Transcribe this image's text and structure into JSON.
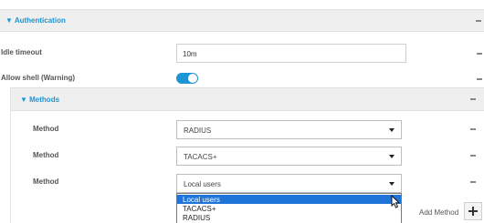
{
  "authentication": {
    "title": "▼ Authentication",
    "idle_timeout": {
      "label": "Idle timeout",
      "value": "10m"
    },
    "allow_shell": {
      "label": "Allow shell (Warning)",
      "enabled": true
    }
  },
  "methods": {
    "title": "▼ Methods",
    "rows": [
      {
        "label": "Method",
        "value": "RADIUS"
      },
      {
        "label": "Method",
        "value": "TACACS+"
      },
      {
        "label": "Method",
        "value": "Local users"
      }
    ],
    "dropdown_options": [
      {
        "label": "Local users",
        "selected": true
      },
      {
        "label": "TACACS+",
        "selected": false
      },
      {
        "label": "RADIUS",
        "selected": false
      }
    ],
    "add_label": "Add Method"
  },
  "colors": {
    "accent": "#1b95d3",
    "selected_option": "#1e74d8",
    "header_bg": "#efefef"
  },
  "icons": {
    "expand": "triangle-down-icon",
    "row_menu": "dash-icon",
    "select_caret": "caret-down-icon",
    "add": "plus-icon",
    "pointer": "mouse-cursor-icon"
  }
}
